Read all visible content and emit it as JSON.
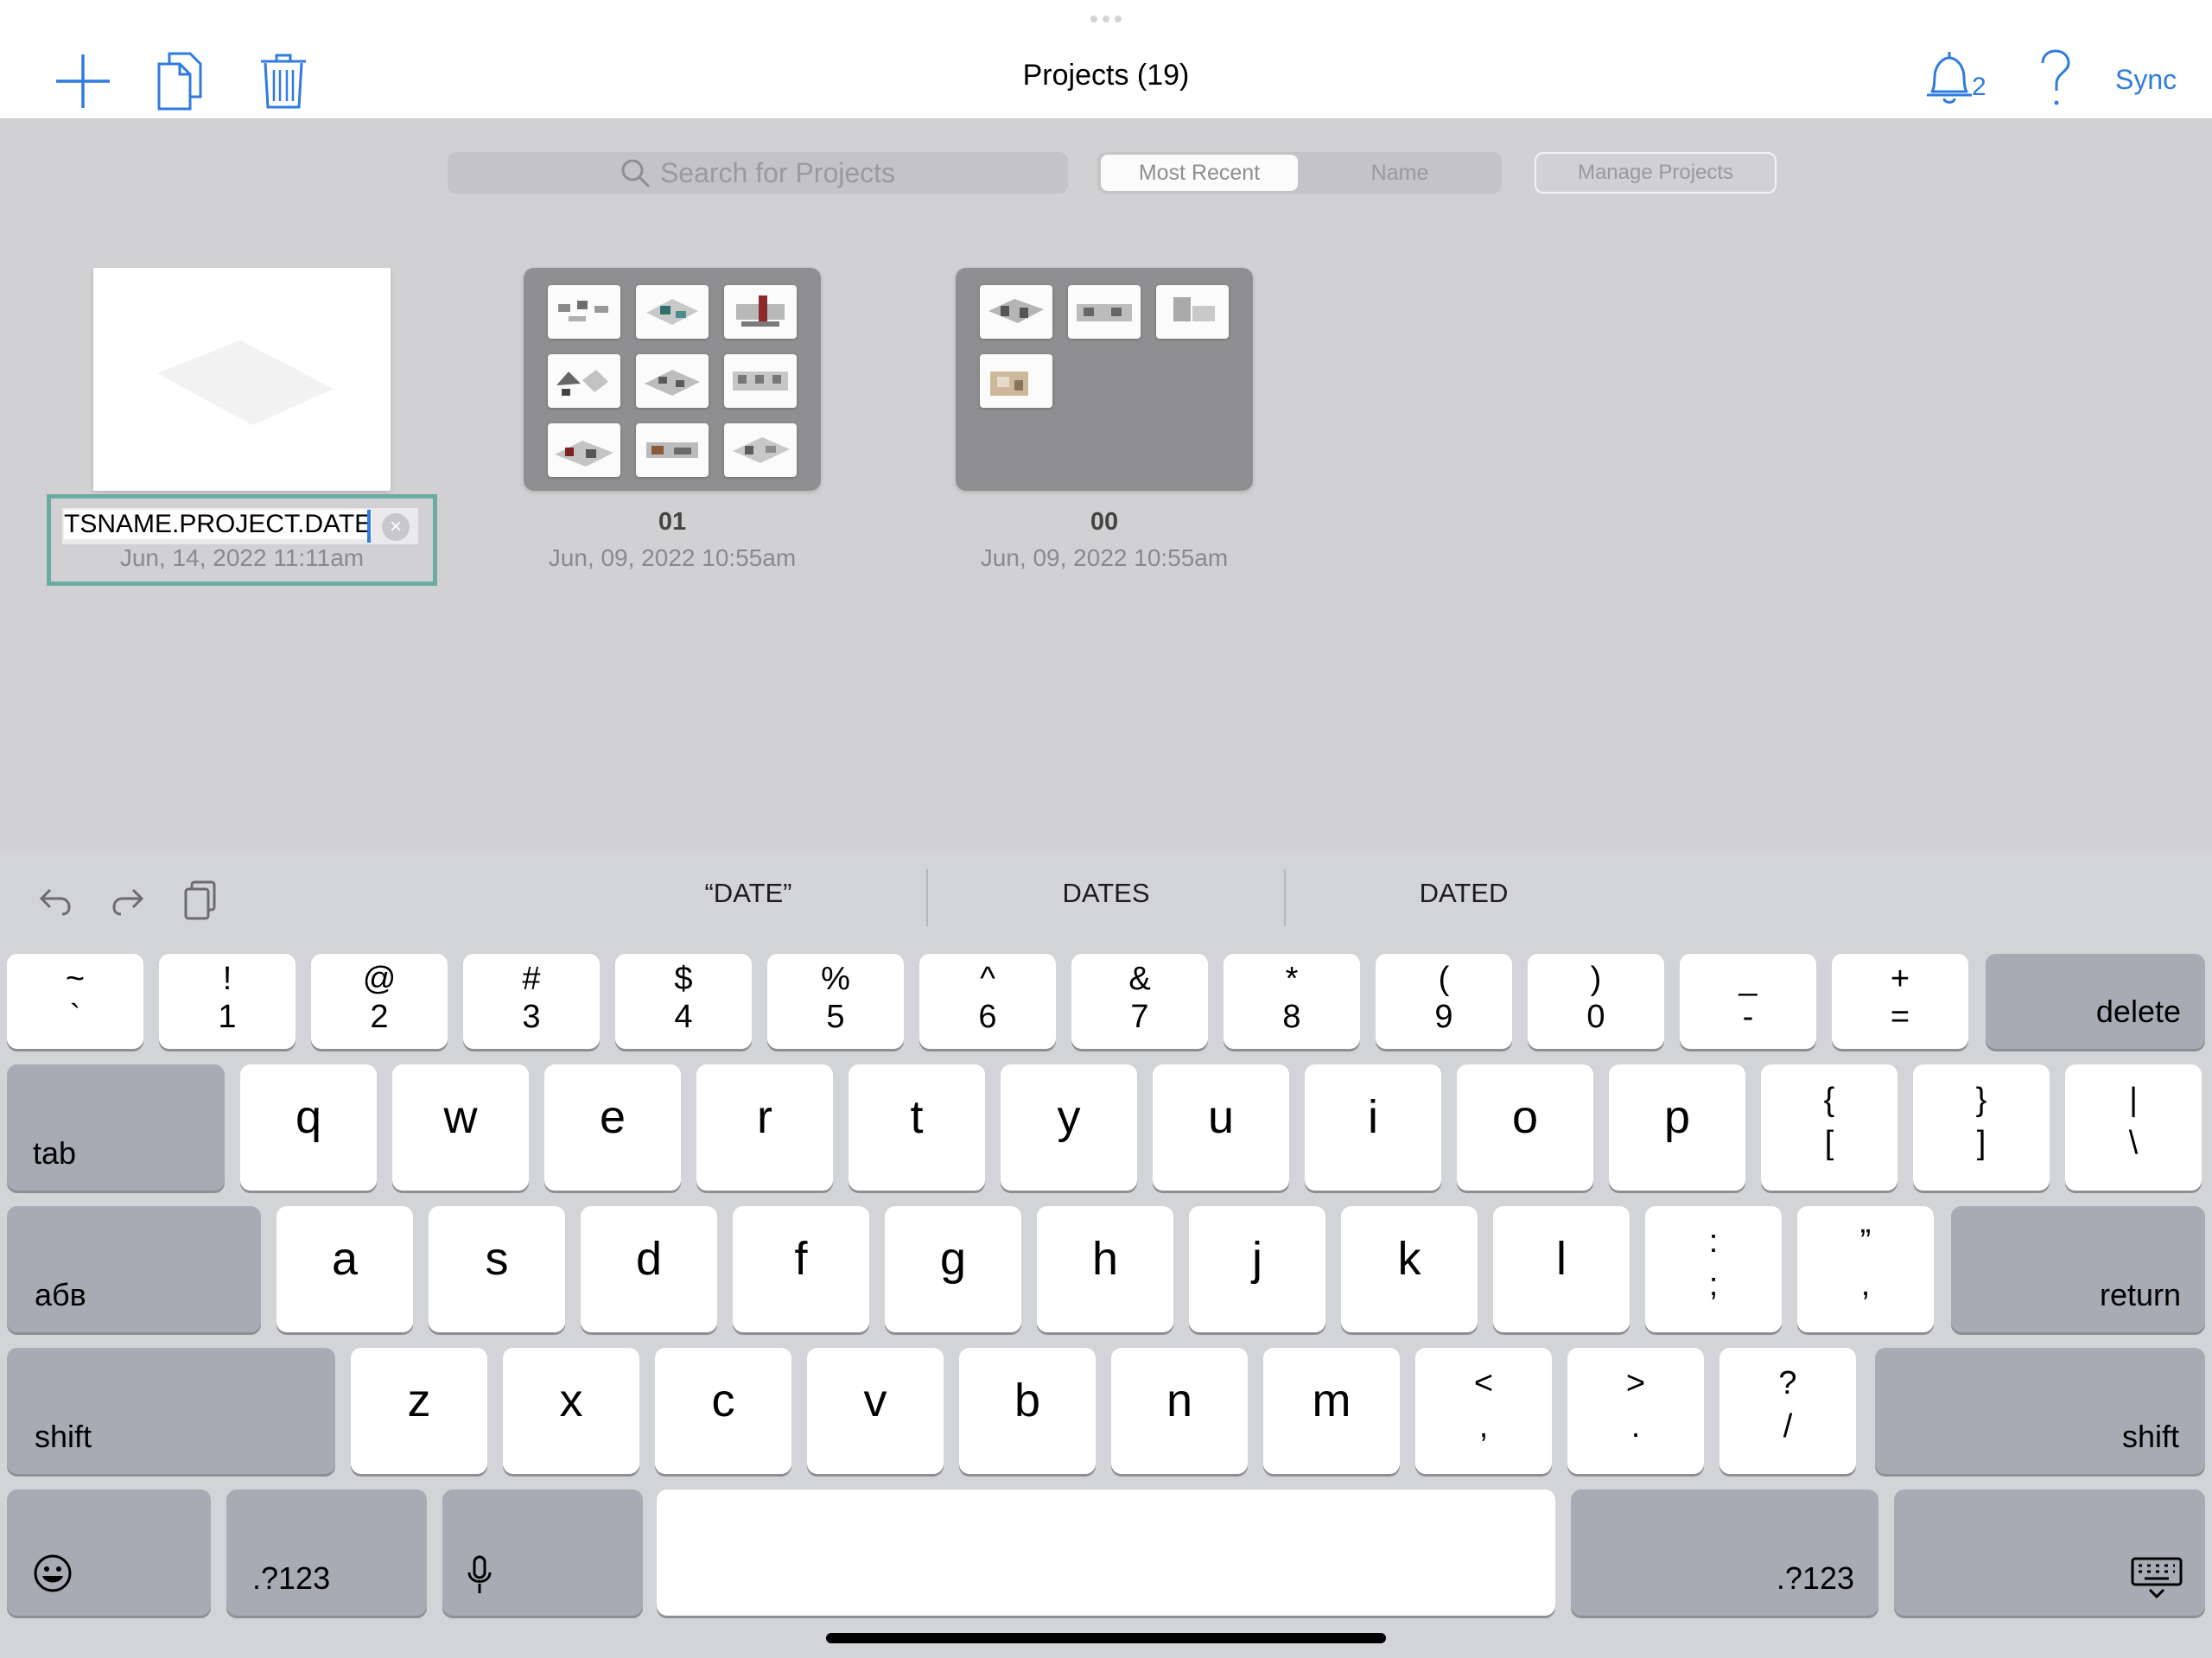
{
  "nav": {
    "title": "Projects (19)",
    "notification_count": "2",
    "sync_label": "Sync",
    "icons": [
      "plus-icon",
      "duplicate-icon",
      "trash-icon",
      "bell-icon",
      "help-icon"
    ]
  },
  "filter": {
    "search_placeholder": "Search for Projects",
    "sort_options": [
      "Most Recent",
      "Name"
    ],
    "selected_sort": "Most Recent",
    "manage_label": "Manage Projects"
  },
  "projects": [
    {
      "name": "TSNAME.PROJECT.DATE",
      "date": "Jun, 14, 2022 11:11am",
      "editing": true
    },
    {
      "name": "01",
      "date": "Jun, 09, 2022 10:55am",
      "editing": false
    },
    {
      "name": "00",
      "date": "Jun, 09, 2022 10:55am",
      "editing": false
    }
  ],
  "keyboard": {
    "suggestions": [
      "“DATE”",
      "DATES",
      "DATED"
    ],
    "number_row": [
      {
        "top": "~",
        "bottom": "`"
      },
      {
        "top": "!",
        "bottom": "1"
      },
      {
        "top": "@",
        "bottom": "2"
      },
      {
        "top": "#",
        "bottom": "3"
      },
      {
        "top": "$",
        "bottom": "4"
      },
      {
        "top": "%",
        "bottom": "5"
      },
      {
        "top": "^",
        "bottom": "6"
      },
      {
        "top": "&",
        "bottom": "7"
      },
      {
        "top": "*",
        "bottom": "8"
      },
      {
        "top": "(",
        "bottom": "9"
      },
      {
        "top": ")",
        "bottom": "0"
      },
      {
        "top": "_",
        "bottom": "-"
      },
      {
        "top": "+",
        "bottom": "="
      }
    ],
    "row_q": [
      "q",
      "w",
      "e",
      "r",
      "t",
      "y",
      "u",
      "i",
      "o",
      "p"
    ],
    "row_q_symbols": [
      {
        "top": "{",
        "bottom": "["
      },
      {
        "top": "}",
        "bottom": "]"
      },
      {
        "top": "|",
        "bottom": "\\"
      }
    ],
    "row_a": [
      "a",
      "s",
      "d",
      "f",
      "g",
      "h",
      "j",
      "k",
      "l"
    ],
    "row_a_symbols": [
      {
        "top": ":",
        "bottom": ";"
      },
      {
        "top": "”",
        "bottom": ","
      }
    ],
    "row_z": [
      "z",
      "x",
      "c",
      "v",
      "b",
      "n",
      "m"
    ],
    "row_z_symbols": [
      {
        "top": "<",
        "bottom": ","
      },
      {
        "top": ">",
        "bottom": "."
      },
      {
        "top": "?",
        "bottom": "/"
      }
    ],
    "labels": {
      "delete": "delete",
      "tab": "tab",
      "language": "абв",
      "return": "return",
      "shift": "shift",
      "numbers": ".?123"
    }
  }
}
